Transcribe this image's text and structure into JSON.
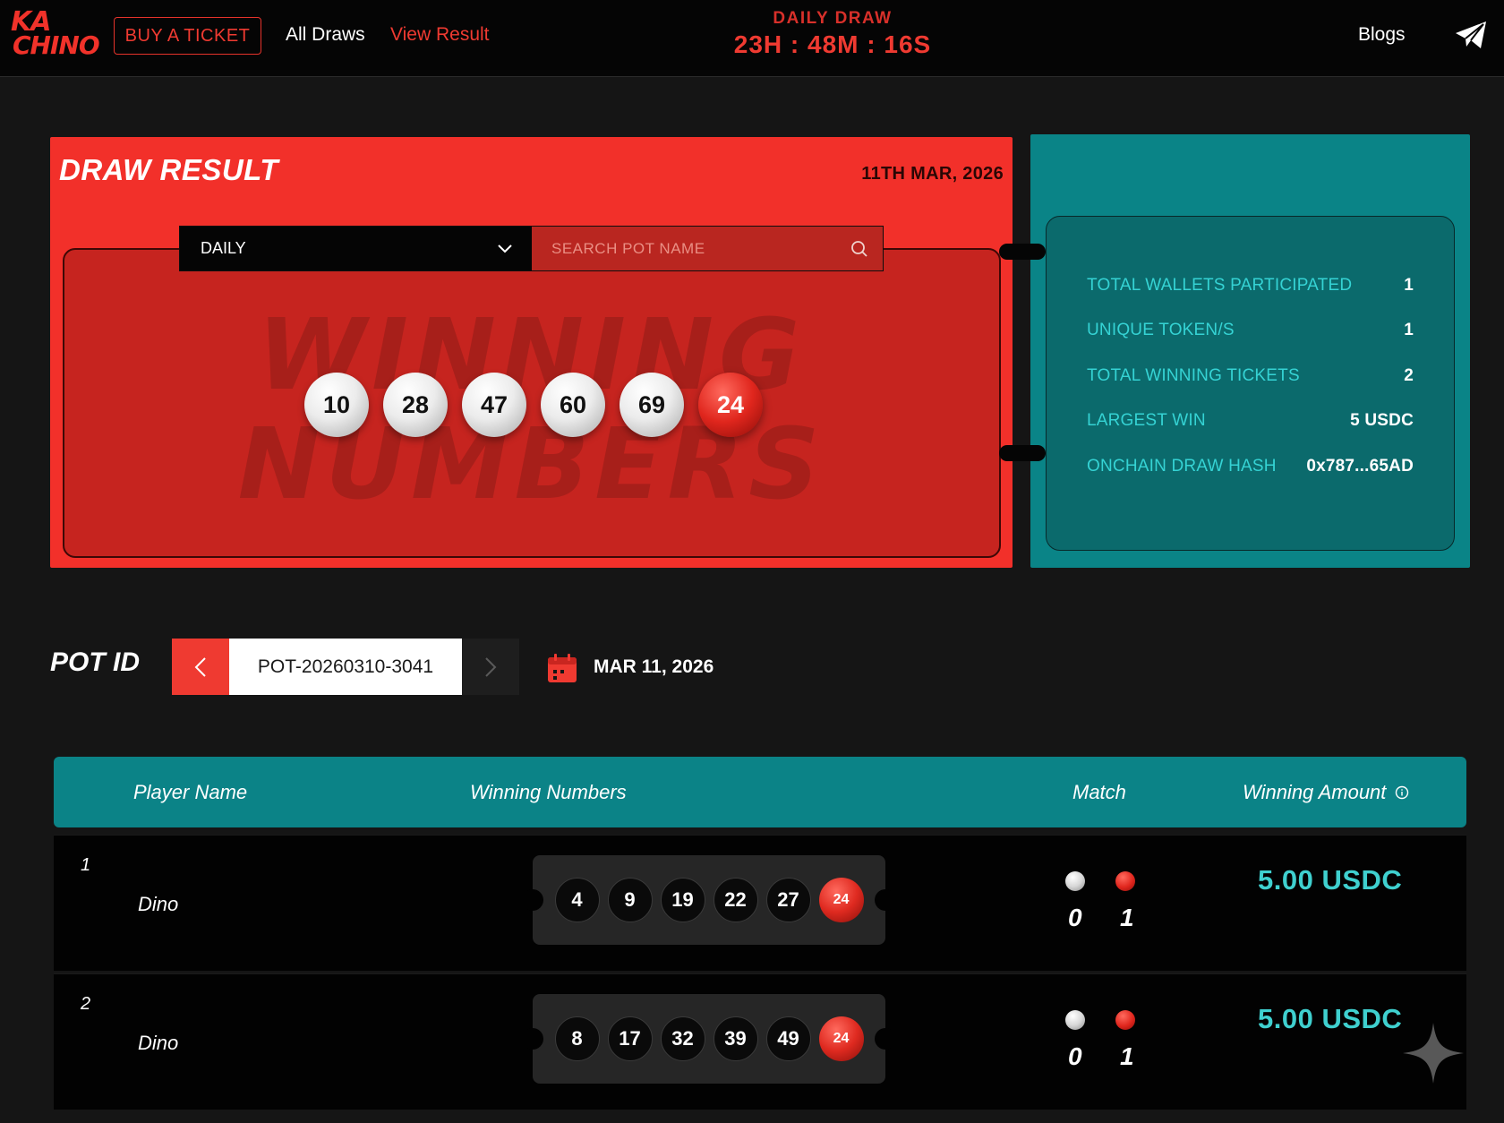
{
  "header": {
    "logo_line1": "KA",
    "logo_line2": "CHINO",
    "buy_ticket": "BUY A TICKET",
    "nav_all_draws": "All Draws",
    "nav_view_result": "View Result",
    "draw_label": "DAILY DRAW",
    "countdown": "23H : 48M : 16S",
    "blogs": "Blogs",
    "send_icon": "telegram-icon"
  },
  "draw_result": {
    "title": "DRAW RESULT",
    "date": "11TH MAR, 2026",
    "select_value": "DAILY",
    "search_placeholder": "SEARCH POT NAME",
    "watermark_line1": "WINNING",
    "watermark_line2": "NUMBERS",
    "main_numbers": [
      "10",
      "28",
      "47",
      "60",
      "69"
    ],
    "bonus_number": "24"
  },
  "stats": {
    "rows": [
      {
        "label": "TOTAL WALLETS PARTICIPATED",
        "value": "1"
      },
      {
        "label": "UNIQUE TOKEN/S",
        "value": "1"
      },
      {
        "label": "TOTAL WINNING TICKETS",
        "value": "2"
      },
      {
        "label": "LARGEST WIN",
        "value": "5 USDC"
      },
      {
        "label": "ONCHAIN DRAW HASH",
        "value": "0x787...65AD"
      }
    ]
  },
  "pot": {
    "label": "POT ID",
    "id": "POT-20260310-3041",
    "date": "MAR 11, 2026"
  },
  "table": {
    "headers": {
      "player": "Player Name",
      "numbers": "Winning Numbers",
      "match": "Match",
      "amount": "Winning Amount"
    },
    "rows": [
      {
        "index": "1",
        "name": "Dino",
        "numbers": [
          "4",
          "9",
          "19",
          "22",
          "27"
        ],
        "bonus": "24",
        "match_white": "0",
        "match_red": "1",
        "amount": "5.00 USDC"
      },
      {
        "index": "2",
        "name": "Dino",
        "numbers": [
          "8",
          "17",
          "32",
          "39",
          "49"
        ],
        "bonus": "24",
        "match_white": "0",
        "match_red": "1",
        "amount": "5.00 USDC"
      }
    ]
  },
  "colors": {
    "accent_red": "#f2302a",
    "accent_teal": "#0a8487",
    "amount_teal": "#3fd0cf",
    "background": "#151515"
  }
}
